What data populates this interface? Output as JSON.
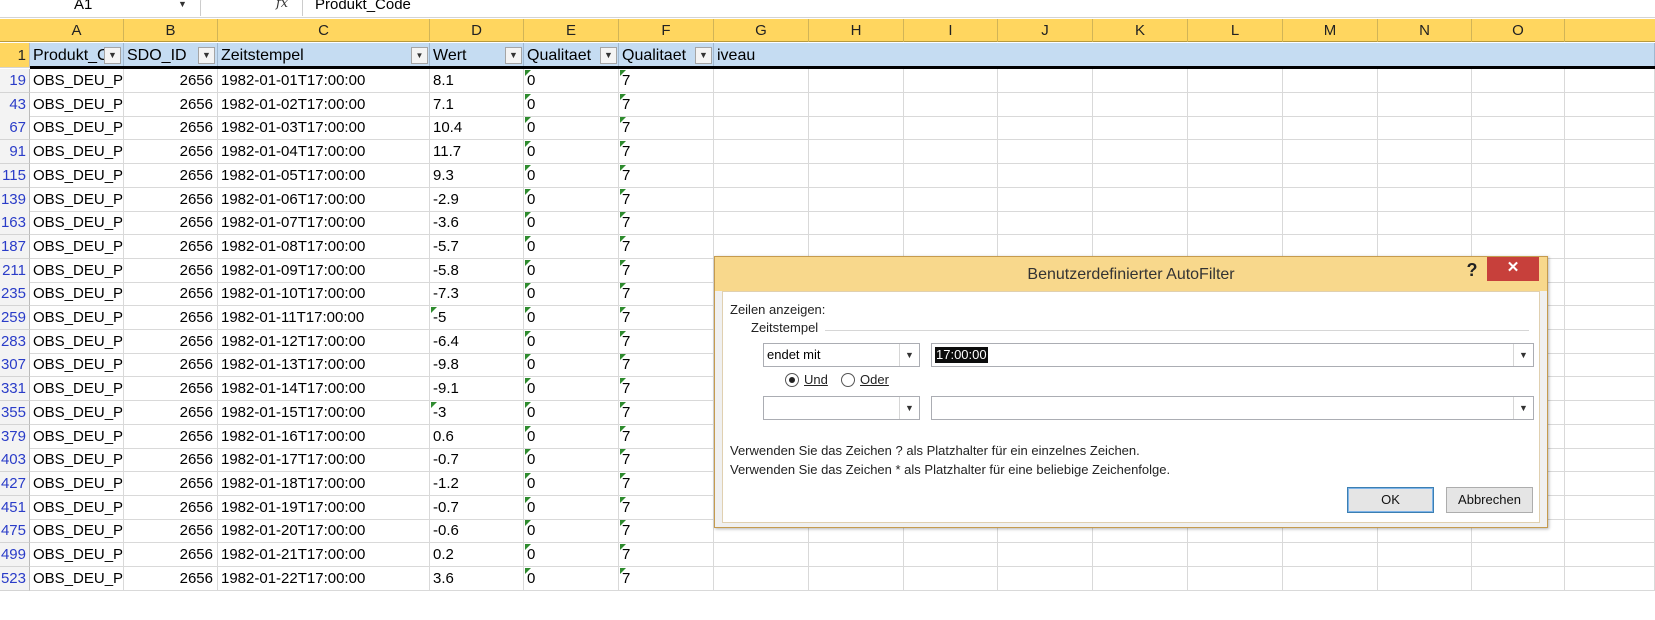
{
  "formula_bar": {
    "name_box": "A1",
    "fx": "fx",
    "formula": "Produkt_Code"
  },
  "columns": [
    "A",
    "B",
    "C",
    "D",
    "E",
    "F",
    "G",
    "H",
    "I",
    "J",
    "K",
    "L",
    "M",
    "N",
    "O"
  ],
  "header_row": {
    "row_number": "1",
    "headers": [
      "Produkt_C",
      "SDO_ID",
      "Zeitstempel",
      "Wert",
      "Qualitaet",
      "Qualitaet",
      "iveau"
    ],
    "active_filter_column": "Zeitstempel"
  },
  "rows": [
    {
      "rownum": "19",
      "a": "OBS_DEU_PT",
      "b": "2656",
      "c": "1982-01-01T17:00:00",
      "d": "8.1",
      "e": "0",
      "f": "7"
    },
    {
      "rownum": "43",
      "a": "OBS_DEU_PT",
      "b": "2656",
      "c": "1982-01-02T17:00:00",
      "d": "7.1",
      "e": "0",
      "f": "7"
    },
    {
      "rownum": "67",
      "a": "OBS_DEU_PT",
      "b": "2656",
      "c": "1982-01-03T17:00:00",
      "d": "10.4",
      "e": "0",
      "f": "7"
    },
    {
      "rownum": "91",
      "a": "OBS_DEU_PT",
      "b": "2656",
      "c": "1982-01-04T17:00:00",
      "d": "11.7",
      "e": "0",
      "f": "7"
    },
    {
      "rownum": "115",
      "a": "OBS_DEU_PT",
      "b": "2656",
      "c": "1982-01-05T17:00:00",
      "d": "9.3",
      "e": "0",
      "f": "7"
    },
    {
      "rownum": "139",
      "a": "OBS_DEU_PT",
      "b": "2656",
      "c": "1982-01-06T17:00:00",
      "d": "-2.9",
      "e": "0",
      "f": "7"
    },
    {
      "rownum": "163",
      "a": "OBS_DEU_PT",
      "b": "2656",
      "c": "1982-01-07T17:00:00",
      "d": "-3.6",
      "e": "0",
      "f": "7"
    },
    {
      "rownum": "187",
      "a": "OBS_DEU_PT",
      "b": "2656",
      "c": "1982-01-08T17:00:00",
      "d": "-5.7",
      "e": "0",
      "f": "7"
    },
    {
      "rownum": "211",
      "a": "OBS_DEU_PT",
      "b": "2656",
      "c": "1982-01-09T17:00:00",
      "d": "-5.8",
      "e": "0",
      "f": "7"
    },
    {
      "rownum": "235",
      "a": "OBS_DEU_PT",
      "b": "2656",
      "c": "1982-01-10T17:00:00",
      "d": "-7.3",
      "e": "0",
      "f": "7"
    },
    {
      "rownum": "259",
      "a": "OBS_DEU_PT",
      "b": "2656",
      "c": "1982-01-11T17:00:00",
      "d": "-5",
      "e": "0",
      "f": "7"
    },
    {
      "rownum": "283",
      "a": "OBS_DEU_PT",
      "b": "2656",
      "c": "1982-01-12T17:00:00",
      "d": "-6.4",
      "e": "0",
      "f": "7"
    },
    {
      "rownum": "307",
      "a": "OBS_DEU_PT",
      "b": "2656",
      "c": "1982-01-13T17:00:00",
      "d": "-9.8",
      "e": "0",
      "f": "7"
    },
    {
      "rownum": "331",
      "a": "OBS_DEU_PT",
      "b": "2656",
      "c": "1982-01-14T17:00:00",
      "d": "-9.1",
      "e": "0",
      "f": "7"
    },
    {
      "rownum": "355",
      "a": "OBS_DEU_PT",
      "b": "2656",
      "c": "1982-01-15T17:00:00",
      "d": "-3",
      "e": "0",
      "f": "7"
    },
    {
      "rownum": "379",
      "a": "OBS_DEU_PT",
      "b": "2656",
      "c": "1982-01-16T17:00:00",
      "d": "0.6",
      "e": "0",
      "f": "7"
    },
    {
      "rownum": "403",
      "a": "OBS_DEU_PT",
      "b": "2656",
      "c": "1982-01-17T17:00:00",
      "d": "-0.7",
      "e": "0",
      "f": "7"
    },
    {
      "rownum": "427",
      "a": "OBS_DEU_PT",
      "b": "2656",
      "c": "1982-01-18T17:00:00",
      "d": "-1.2",
      "e": "0",
      "f": "7"
    },
    {
      "rownum": "451",
      "a": "OBS_DEU_PT",
      "b": "2656",
      "c": "1982-01-19T17:00:00",
      "d": "-0.7",
      "e": "0",
      "f": "7"
    },
    {
      "rownum": "475",
      "a": "OBS_DEU_PT",
      "b": "2656",
      "c": "1982-01-20T17:00:00",
      "d": "-0.6",
      "e": "0",
      "f": "7"
    },
    {
      "rownum": "499",
      "a": "OBS_DEU_PT",
      "b": "2656",
      "c": "1982-01-21T17:00:00",
      "d": "0.2",
      "e": "0",
      "f": "7"
    },
    {
      "rownum": "523",
      "a": "OBS_DEU_PT",
      "b": "2656",
      "c": "1982-01-22T17:00:00",
      "d": "3.6",
      "e": "0",
      "f": "7"
    }
  ],
  "dialog": {
    "title": "Benutzerdefinierter AutoFilter",
    "help": "?",
    "close": "✕",
    "show_rows_label": "Zeilen anzeigen:",
    "field_label": "Zeitstempel",
    "operator1": "endet mit",
    "value1": "17:00:00",
    "radio_und": "Und",
    "radio_oder": "Oder",
    "selected_logic": "Und",
    "operator2": "",
    "value2": "",
    "hint1": "Verwenden Sie das Zeichen ? als Platzhalter für ein einzelnes Zeichen.",
    "hint2": "Verwenden Sie das Zeichen * als Platzhalter für eine beliebige Zeichenfolge.",
    "ok": "OK",
    "cancel": "Abbrechen"
  },
  "colors": {
    "header_bg": "#ffd65f",
    "header_row_fill": "#c5dcf2",
    "row_number_text": "#2a3cc8",
    "error_triangle": "#2e8b2e",
    "dialog_titlebar": "#f8d88c",
    "close_button": "#c7403b"
  }
}
